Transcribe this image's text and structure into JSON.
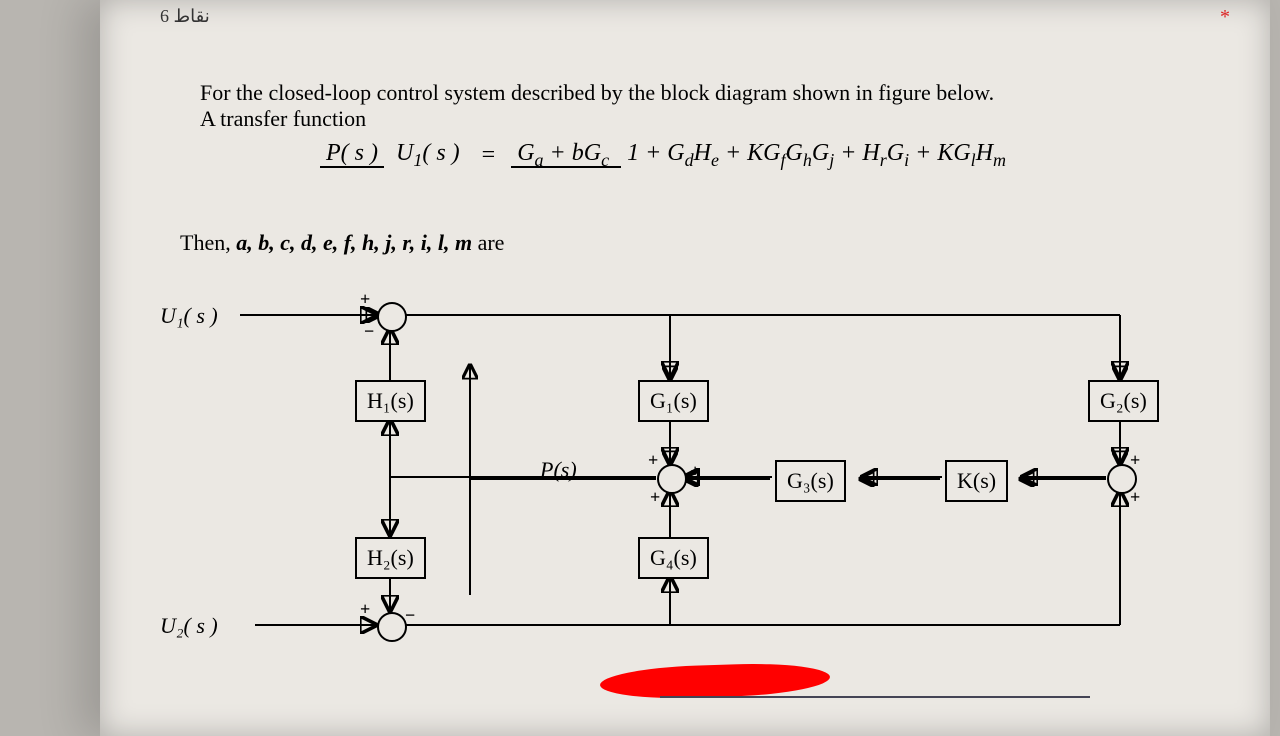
{
  "header": {
    "points": "6 نقاط",
    "required_marker": "*"
  },
  "question": {
    "line1": "For the closed-loop control system described by the block diagram shown in figure below.",
    "line2": "A transfer function",
    "formula": {
      "lhs_num": "P( s )",
      "lhs_den": "U",
      "lhs_den_sub": "1",
      "lhs_den_tail": "( s )",
      "eq": "=",
      "rhs_num_a": "G",
      "rhs_num_asub": "a",
      "rhs_num_plus": " + bG",
      "rhs_num_csub": "c",
      "rhs_den_start": "1 + G",
      "rhs_den_d": "d",
      "rhs_den_H": "H",
      "rhs_den_e": "e",
      "rhs_den_p2": " + KG",
      "rhs_den_f": "f",
      "rhs_den_G2": "G",
      "rhs_den_h": "h",
      "rhs_den_G3": "G",
      "rhs_den_j": "j",
      "rhs_den_p3": " + H",
      "rhs_den_r": "r",
      "rhs_den_G4": "G",
      "rhs_den_i": "i",
      "rhs_den_p4": " + KG",
      "rhs_den_l": "l",
      "rhs_den_H2": "H",
      "rhs_den_m": "m"
    },
    "then_prefix": "Then,   ",
    "then_vars": "a, b, c, d, e, f, h, j, r, i, l, m",
    "then_suffix": "   are"
  },
  "diagram": {
    "inputs": {
      "u1": "U₁( s )",
      "u2": "U₂( s )"
    },
    "blocks": {
      "h1": "H₁(s)",
      "h2": "H₂(s)",
      "g1": "G₁(s)",
      "g4": "G₄(s)",
      "g3": "G₃(s)",
      "k": "K(s)",
      "g2": "G₂(s)",
      "p": "P(s)"
    },
    "signs": {
      "s1_top": "+",
      "s1_bot": "−",
      "s4_top": "+",
      "s4_bot": "−",
      "s2_top": "+",
      "s2_right": "+",
      "s2_bot": "+",
      "s3_top": "+",
      "s3_bot": "+"
    }
  }
}
